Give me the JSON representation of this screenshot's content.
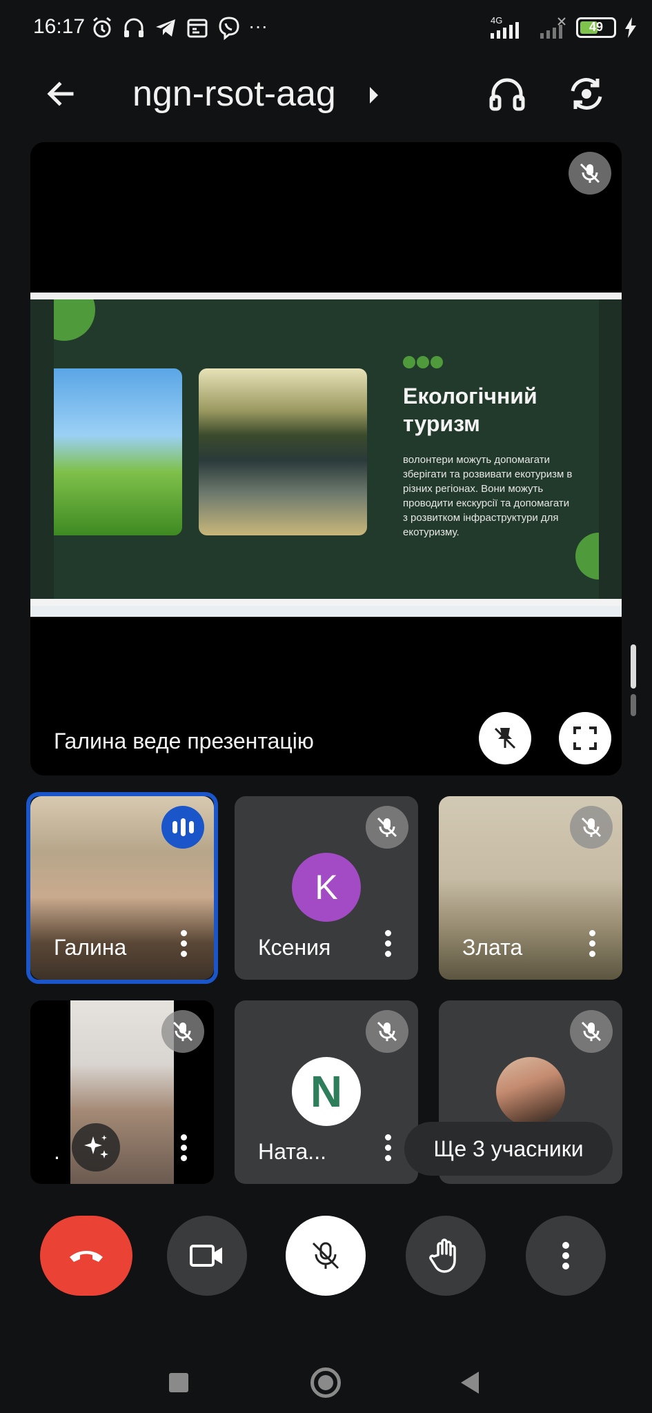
{
  "status_bar": {
    "time": "16:17",
    "network": "4G",
    "battery": "49",
    "more": "···"
  },
  "app_bar": {
    "meeting_code": "ngn-rsot-aag"
  },
  "presentation": {
    "slide_title": "Екологічний туризм",
    "slide_body": "волонтери можуть допомагати зберігати та розвивати екотуризм в різних регіонах. Вони можуть проводити екскурсії та допомагати з розвитком інфраструктури для екотуризму.",
    "presenter_label": "Галина веде презентацію"
  },
  "participants": [
    {
      "name": "Галина",
      "speaking": true,
      "avatar": "camera"
    },
    {
      "name": "Ксения",
      "avatar_letter": "K",
      "muted": true
    },
    {
      "name": "Злата",
      "muted": true,
      "avatar": "camera"
    },
    {
      "name": ".",
      "muted": true,
      "avatar": "camera"
    },
    {
      "name": "Ната...",
      "muted": true,
      "avatar_letter": "N"
    },
    {
      "name": "",
      "muted": true,
      "avatar": "photo"
    }
  ],
  "more_participants": "Ще 3 учасники",
  "colors": {
    "speaking_accent": "#1a56c9",
    "end_call": "#ea4335",
    "avatar_k": "#a34bc4",
    "slide_green": "#4f9a3b"
  }
}
